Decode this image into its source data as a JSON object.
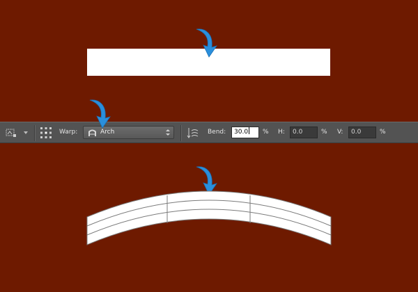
{
  "toolbar": {
    "warp_label": "Warp:",
    "warp_style": "Arch",
    "bend_label": "Bend:",
    "bend_value": "30.0",
    "bend_unit": "%",
    "h_label": "H:",
    "h_value": "0.0",
    "h_unit": "%",
    "v_label": "V:",
    "v_value": "0.0",
    "v_unit": "%"
  },
  "colors": {
    "canvas_bg": "#6e1a00",
    "toolbar_bg": "#535353",
    "arrow": "#2a8fdc"
  }
}
